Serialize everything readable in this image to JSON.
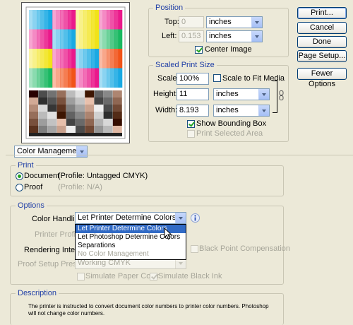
{
  "position": {
    "title": "Position",
    "top_label": "Top:",
    "top_value": "0",
    "top_unit": "inches",
    "left_label": "Left:",
    "left_value": "0.153",
    "left_unit": "inches",
    "center_image": "Center Image"
  },
  "buttons": {
    "print": "Print...",
    "cancel": "Cancel",
    "done": "Done",
    "page_setup": "Page Setup...",
    "fewer_options": "Fewer Options"
  },
  "scaled": {
    "title": "Scaled Print Size",
    "scale_label": "Scale:",
    "scale_value": "100%",
    "scale_to_fit": "Scale to Fit Media",
    "height_label": "Height:",
    "height_value": "11",
    "height_unit": "inches",
    "width_label": "Width:",
    "width_value": "8.193",
    "width_unit": "inches",
    "show_bbox": "Show Bounding Box",
    "print_selected": "Print Selected Area"
  },
  "mode_select": "Color Management",
  "print_group": {
    "title": "Print",
    "document": "Document",
    "document_profile": "(Profile: Untagged CMYK)",
    "proof": "Proof",
    "proof_profile": "(Profile: N/A)"
  },
  "options": {
    "title": "Options",
    "color_handling_label": "Color Handling:",
    "color_handling_value": "Let Printer Determine Colors",
    "dropdown_items": [
      "Let Printer Determine Colors",
      "Let Photoshop Determine Colors",
      "Separations",
      "No Color Management"
    ],
    "printer_profile_label": "Printer Profile:",
    "rendering_intent_label": "Rendering Intent:",
    "black_point": "Black Point Compensation",
    "proof_setup_label": "Proof Setup Preset:",
    "proof_setup_value": "Working CMYK",
    "simulate_paper": "Simulate Paper Color",
    "simulate_black": "Simulate Black Ink"
  },
  "description": {
    "title": "Description",
    "text": "The printer is instructed to convert document color numbers to printer color numbers. Photoshop will not change color numbers."
  },
  "colors": {
    "group_title": "#1f3ea6",
    "highlight": "#316ac5",
    "button_border": "#003c74"
  }
}
